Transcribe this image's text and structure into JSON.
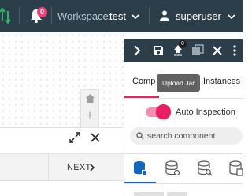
{
  "topbar": {
    "notification_count": "0",
    "workspace_label": "Workspace:",
    "workspace_value": "test",
    "username": "superuser"
  },
  "canvas": {
    "zoom_in_label": "+",
    "zoom_out_label": "−"
  },
  "footer": {
    "next_label": "NEXT"
  },
  "right_panel": {
    "toolbar": {
      "upload_badge": "0",
      "tooltip": "Upload Jar"
    },
    "tabs": [
      {
        "label": "Components",
        "active": true
      },
      {
        "label": "Instances",
        "active": false
      }
    ],
    "auto_inspection": {
      "label": "Auto Inspection",
      "enabled": true
    },
    "search": {
      "placeholder": "search component",
      "value": ""
    }
  },
  "colors": {
    "topbar_bg": "#2c3e4a",
    "accent_pink": "#e91e63",
    "icon_blue": "#1565c0",
    "swap_icon_green": "#2fb36a"
  }
}
